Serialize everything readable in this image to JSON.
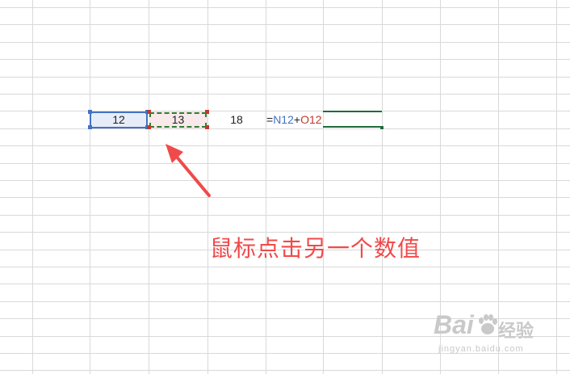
{
  "cells": {
    "n12": "12",
    "o12": "13",
    "p12": "18",
    "formula": {
      "eq": "=",
      "ref1": "N12",
      "plus": "+",
      "ref2": "O12"
    }
  },
  "annotation": "鼠标点击另一个数值",
  "watermark": {
    "brand": "Bai",
    "brand_cn": "经验",
    "sub": "jingyan.baidu.com"
  },
  "colors": {
    "ref_blue": "#4472c4",
    "ref_red": "#c0392b",
    "active_green": "#1e6b3c",
    "annotation_red": "#f04a4a"
  }
}
